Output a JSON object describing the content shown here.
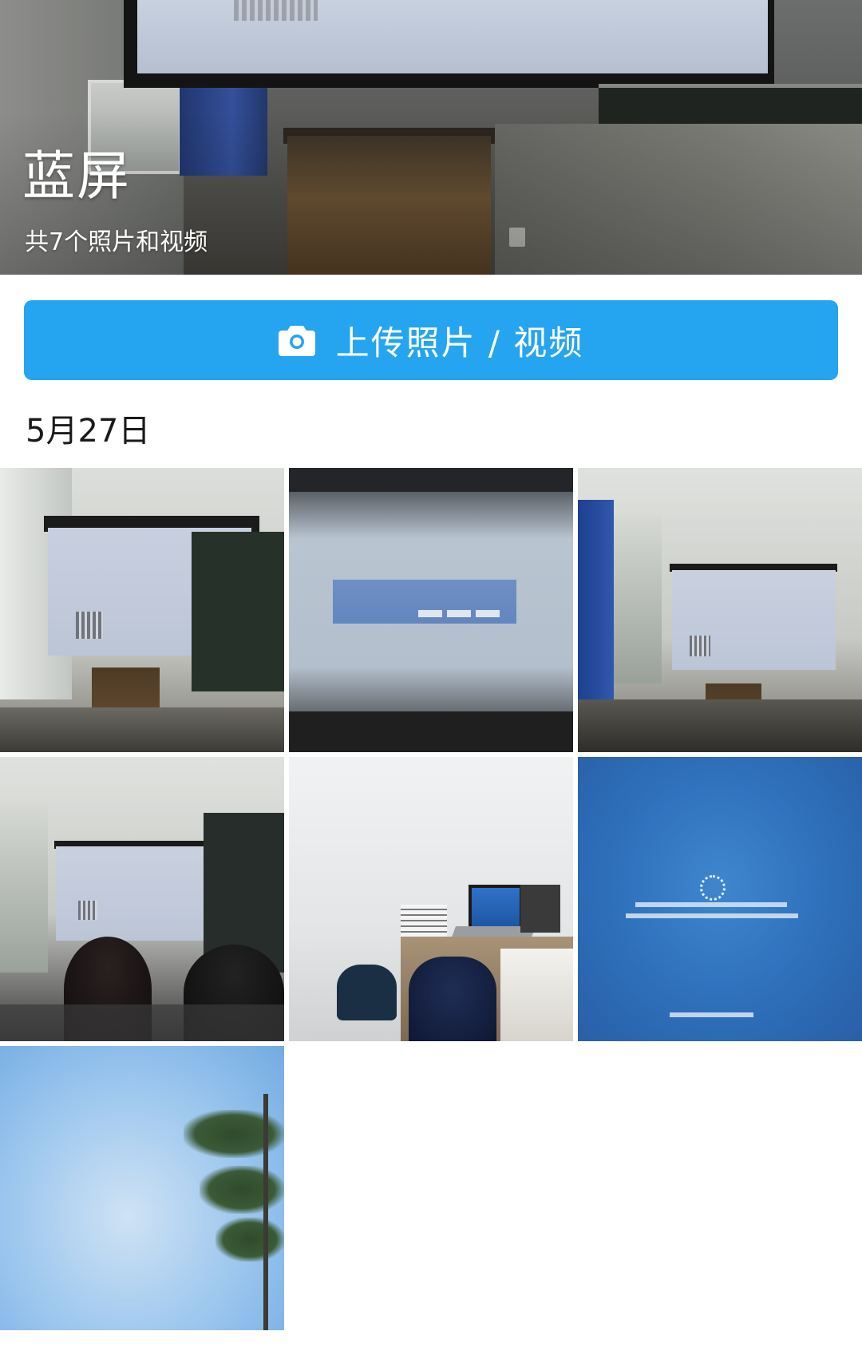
{
  "album": {
    "title": "蓝屏",
    "count_text": "共7个照片和视频"
  },
  "upload": {
    "label": "上传照片 / 视频",
    "icon": "camera-icon",
    "color": "#25a4f0"
  },
  "sections": [
    {
      "date": "5月27日",
      "photos": [
        {
          "name": "photo-1",
          "subject": "classroom-projector-bsod"
        },
        {
          "name": "photo-2",
          "subject": "projector-update-dialog"
        },
        {
          "name": "photo-3",
          "subject": "classroom-projector-bsod"
        },
        {
          "name": "photo-4",
          "subject": "classroom-projector-students"
        },
        {
          "name": "photo-5",
          "subject": "office-laptop-desk"
        },
        {
          "name": "photo-6",
          "subject": "windows-update-screen"
        },
        {
          "name": "photo-7",
          "subject": "sky-and-tree"
        }
      ]
    }
  ]
}
